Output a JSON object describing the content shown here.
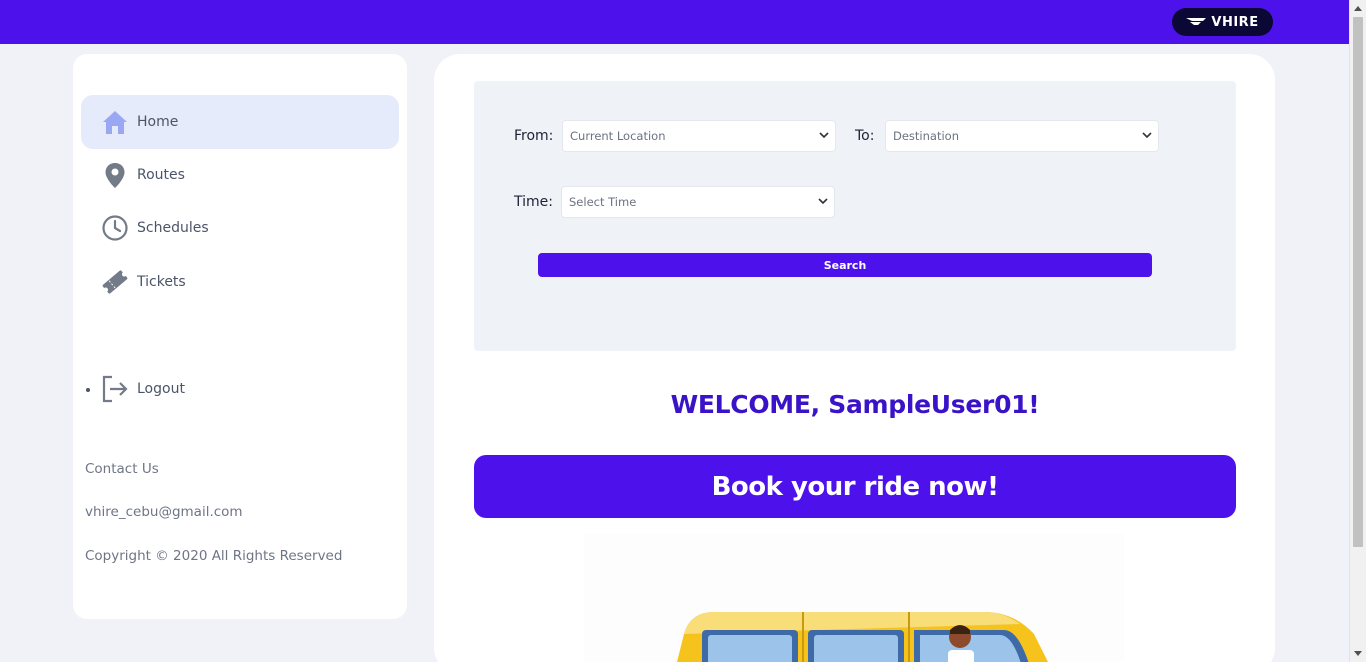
{
  "header": {
    "logo_text": "VHIRE",
    "logo_icon": "wing-icon",
    "bg_color": "#4d12ec"
  },
  "sidebar": {
    "items": [
      {
        "label": "Home",
        "icon": "home-icon",
        "active": true
      },
      {
        "label": "Routes",
        "icon": "map-pin-icon",
        "active": false
      },
      {
        "label": "Schedules",
        "icon": "clock-icon",
        "active": false
      },
      {
        "label": "Tickets",
        "icon": "ticket-icon",
        "active": false
      }
    ],
    "logout_label": "Logout",
    "contact_label": "Contact Us",
    "email": "vhire_cebu@gmail.com",
    "copyright": "Copyright © 2020 All Rights Reserved"
  },
  "search": {
    "from_label": "From:",
    "from_value": "Current Location",
    "to_label": "To:",
    "to_value": "Destination",
    "time_label": "Time:",
    "time_value": "Select Time",
    "button_label": "Search"
  },
  "main": {
    "welcome": "WELCOME, SampleUser01!",
    "cta": "Book your ride now!"
  },
  "colors": {
    "accent": "#4d12ec",
    "welcome_text": "#3a13c8",
    "sidebar_active": "#e6ebfc"
  }
}
